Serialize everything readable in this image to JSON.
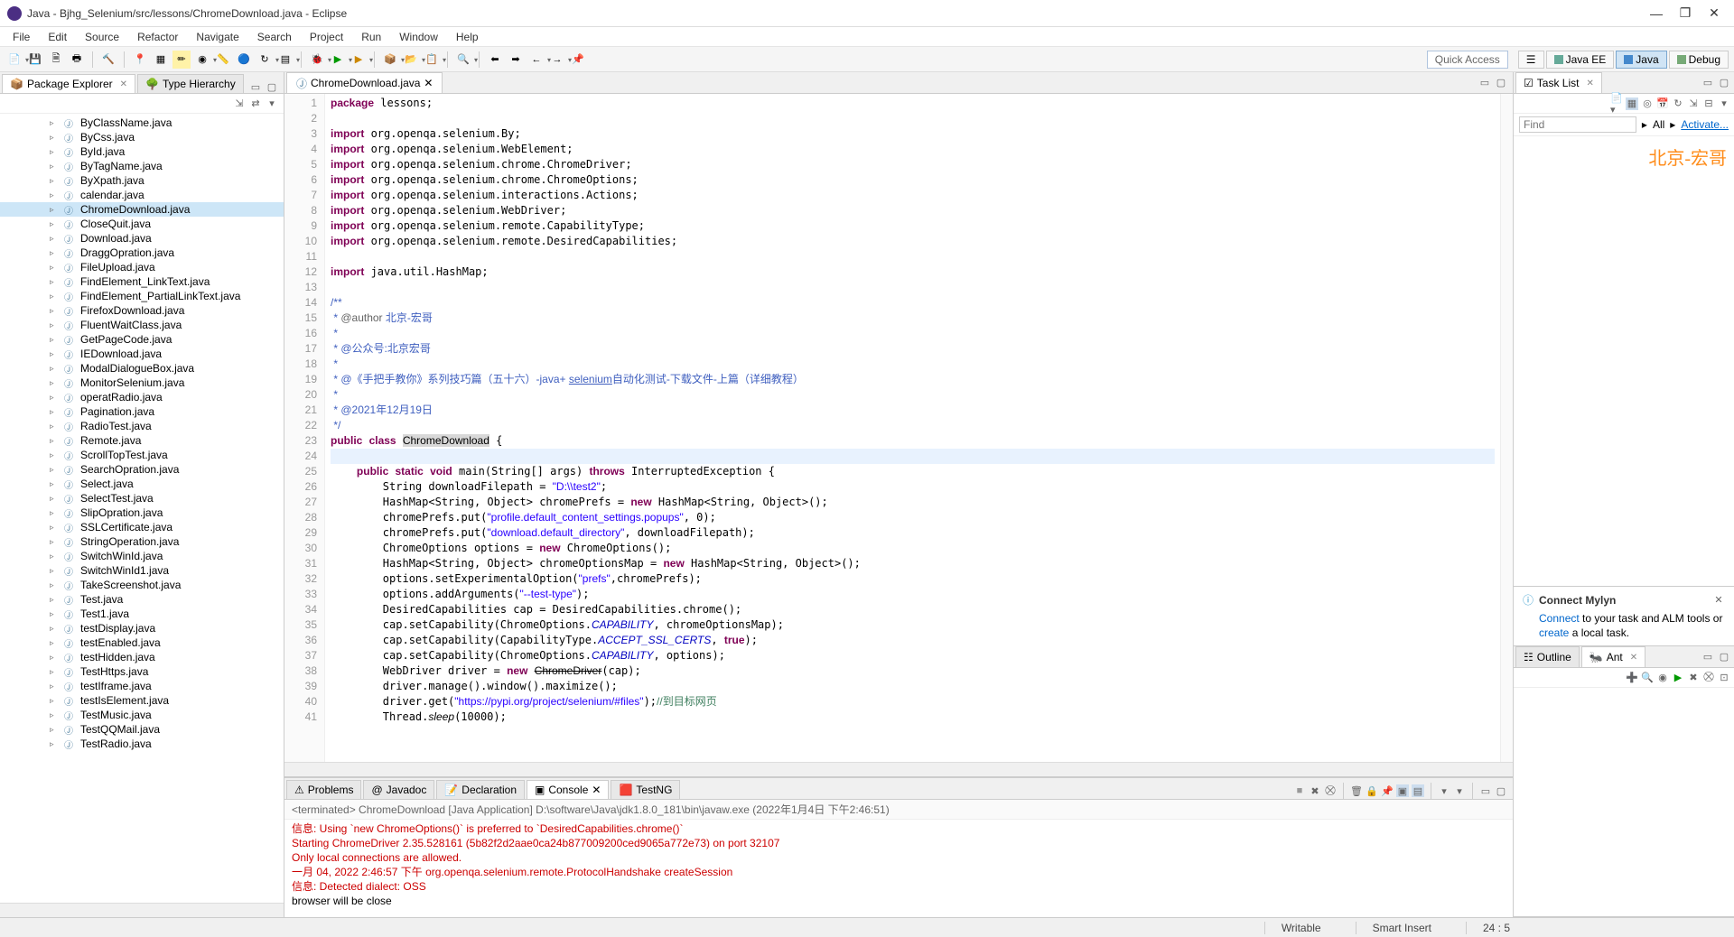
{
  "window": {
    "title": "Java - Bjhg_Selenium/src/lessons/ChromeDownload.java - Eclipse"
  },
  "menu": [
    "File",
    "Edit",
    "Source",
    "Refactor",
    "Navigate",
    "Search",
    "Project",
    "Run",
    "Window",
    "Help"
  ],
  "quick_access": "Quick Access",
  "perspectives": [
    {
      "label": "Java EE",
      "active": false
    },
    {
      "label": "Java",
      "active": true
    },
    {
      "label": "Debug",
      "active": false
    }
  ],
  "left": {
    "tabs": [
      {
        "label": "Package Explorer",
        "active": true
      },
      {
        "label": "Type Hierarchy",
        "active": false
      }
    ],
    "selected": "ChromeDownload.java",
    "files": [
      "ByClassName.java",
      "ByCss.java",
      "ById.java",
      "ByTagName.java",
      "ByXpath.java",
      "calendar.java",
      "ChromeDownload.java",
      "CloseQuit.java",
      "Download.java",
      "DraggOpration.java",
      "FileUpload.java",
      "FindElement_LinkText.java",
      "FindElement_PartialLinkText.java",
      "FirefoxDownload.java",
      "FluentWaitClass.java",
      "GetPageCode.java",
      "IEDownload.java",
      "ModalDialogueBox.java",
      "MonitorSelenium.java",
      "operatRadio.java",
      "Pagination.java",
      "RadioTest.java",
      "Remote.java",
      "ScrollTopTest.java",
      "SearchOpration.java",
      "Select.java",
      "SelectTest.java",
      "SlipOpration.java",
      "SSLCertificate.java",
      "StringOperation.java",
      "SwitchWinId.java",
      "SwitchWinId1.java",
      "TakeScreenshot.java",
      "Test.java",
      "Test1.java",
      "testDisplay.java",
      "testEnabled.java",
      "testHidden.java",
      "TestHttps.java",
      "testIframe.java",
      "testIsElement.java",
      "TestMusic.java",
      "TestQQMail.java",
      "TestRadio.java"
    ]
  },
  "editor": {
    "tab": "ChromeDownload.java",
    "lines_start": 1,
    "lines_end": 41
  },
  "bottom": {
    "tabs": [
      "Problems",
      "Javadoc",
      "Declaration",
      "Console",
      "TestNG"
    ],
    "active": "Console",
    "header": "<terminated> ChromeDownload [Java Application] D:\\software\\Java\\jdk1.8.0_181\\bin\\javaw.exe (2022年1月4日 下午2:46:51)",
    "lines": [
      {
        "t": "信息: Using `new ChromeOptions()` is preferred to `DesiredCapabilities.chrome()`",
        "c": "cred"
      },
      {
        "t": "Starting ChromeDriver 2.35.528161 (5b82f2d2aae0ca24b877009200ced9065a772e73) on port 32107",
        "c": "cred"
      },
      {
        "t": "Only local connections are allowed.",
        "c": "cred"
      },
      {
        "t": "一月 04, 2022 2:46:57 下午 org.openqa.selenium.remote.ProtocolHandshake createSession",
        "c": "cred"
      },
      {
        "t": "信息: Detected dialect: OSS",
        "c": "cred"
      },
      {
        "t": "browser will be close",
        "c": ""
      }
    ]
  },
  "right": {
    "task_tab": "Task List",
    "find_placeholder": "Find",
    "all": "All",
    "activate": "Activate...",
    "watermark": "北京-宏哥",
    "mylyn_title": "Connect Mylyn",
    "mylyn_connect": "Connect",
    "mylyn_mid": " to your task and ALM tools or ",
    "mylyn_create": "create",
    "mylyn_end": " a local task.",
    "outline_tab": "Outline",
    "ant_tab": "Ant"
  },
  "status": {
    "writable": "Writable",
    "insert": "Smart Insert",
    "pos": "24 : 5"
  }
}
